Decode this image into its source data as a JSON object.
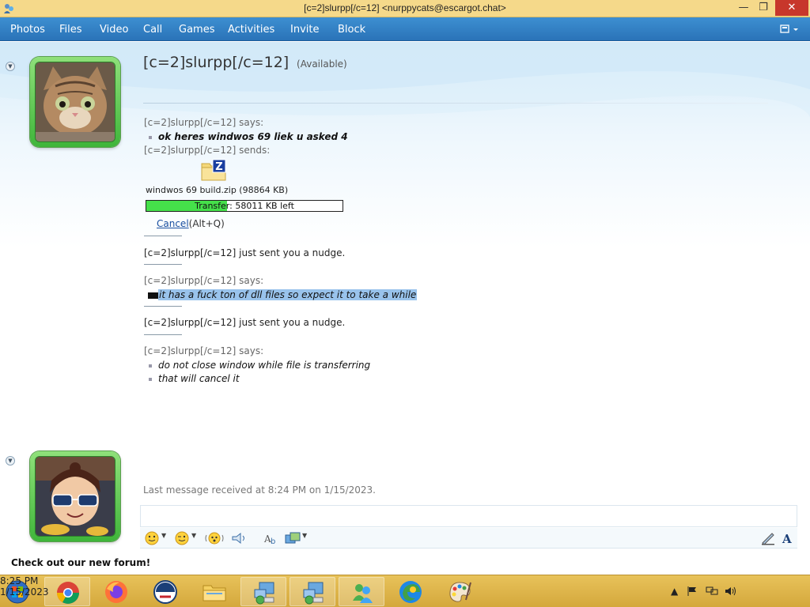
{
  "window": {
    "title": "[c=2]slurpp[/c=12] <nurppycats@escargot.chat>",
    "min_glyph": "—",
    "max_glyph": "❐",
    "close_glyph": "✕"
  },
  "menu": {
    "items": [
      "Photos",
      "Files",
      "Video",
      "Call",
      "Games",
      "Activities",
      "Invite",
      "Block"
    ],
    "layout_button_icon": "layout-icon"
  },
  "contact": {
    "name": "[c=2]slurpp[/c=12]",
    "status": "(Available)",
    "avatar_icon": "kitten-photo"
  },
  "conversation": {
    "says_1": "[c=2]slurpp[/c=12] says:",
    "msg_1": "ok heres windwos 69 liek u asked 4",
    "sends": "[c=2]slurpp[/c=12] sends:",
    "file_icon": "zip-file-icon",
    "file_name": "windwos 69 build.zip (98864 KB)",
    "transfer_label": "Transfer: 58011 KB left",
    "transfer_progress_percent": 41,
    "cancel_label": "Cancel",
    "cancel_shortcut": "(Alt+Q)",
    "nudge_1": "[c=2]slurpp[/c=12] just sent you a nudge.",
    "says_2": "[c=2]slurpp[/c=12] says:",
    "msg_2": "it has a fuck ton of dll files so expect it to take a while",
    "nudge_2": "[c=2]slurpp[/c=12] just sent you a nudge.",
    "says_3": "[c=2]slurpp[/c=12] says:",
    "msg_3": "do not close window while file is transferring",
    "msg_4": "that will cancel it"
  },
  "footer": {
    "last_message": "Last message received at 8:24 PM on 1/15/2023.",
    "forum_link": "Check out our new forum!",
    "self_avatar_icon": "cartoon-avatar"
  },
  "toolbar": {
    "icons": [
      "emoticon-icon",
      "wink-icon",
      "nudge-icon",
      "voice-clip-icon",
      "font-icon",
      "background-icon",
      "handwriting-icon",
      "text-icon"
    ]
  },
  "taskbar": {
    "apps": [
      "start-orb",
      "chrome",
      "firefox",
      "aol",
      "file-explorer",
      "network-app-1",
      "network-app-2",
      "messenger",
      "edge",
      "paint"
    ],
    "active_app": "messenger",
    "clock_time": "8:25 PM",
    "clock_date": "1/15/2023"
  },
  "colors": {
    "menubar": "#2a73b8",
    "titlebar": "#f5d98a",
    "taskbar": "#d4a83c",
    "progress_fill": "#45e04a",
    "selection": "#99c3ec",
    "avatar_frame": "#3fb53a"
  }
}
